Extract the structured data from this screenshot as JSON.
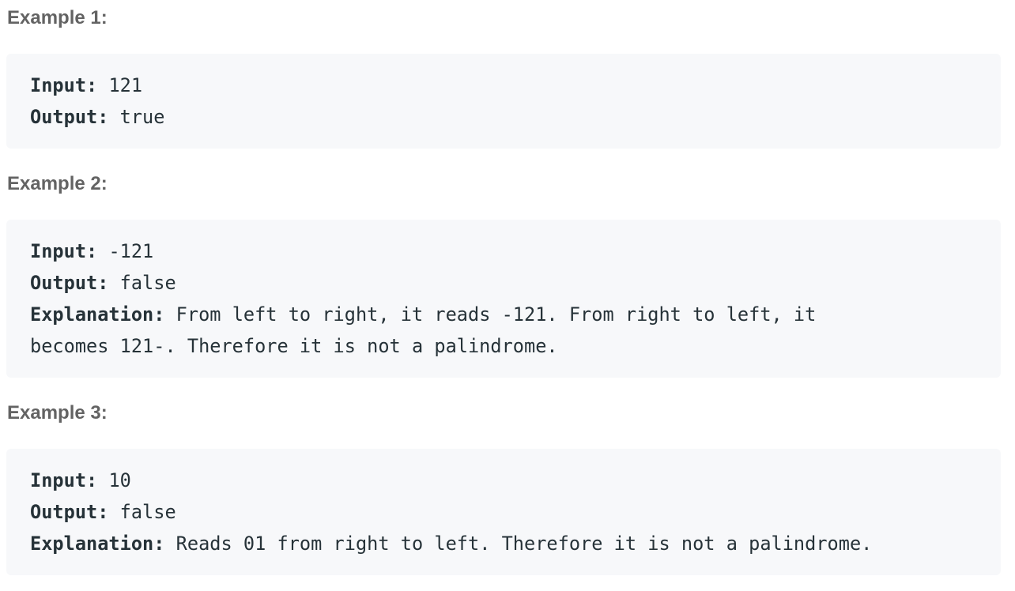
{
  "examples": [
    {
      "heading": "Example 1:",
      "input_label": "Input:",
      "input_value": " 121",
      "output_label": "Output:",
      "output_value": " true"
    },
    {
      "heading": "Example 2:",
      "input_label": "Input:",
      "input_value": " -121",
      "output_label": "Output:",
      "output_value": " false",
      "explanation_label": "Explanation:",
      "explanation_line1": " From left to right, it reads -121. From right to left, it",
      "explanation_line2": "becomes 121-. Therefore it is not a palindrome."
    },
    {
      "heading": "Example 3:",
      "input_label": "Input:",
      "input_value": " 10",
      "output_label": "Output:",
      "output_value": " false",
      "explanation_label": "Explanation:",
      "explanation_line1": " Reads 01 from right to left. Therefore it is not a palindrome."
    }
  ]
}
